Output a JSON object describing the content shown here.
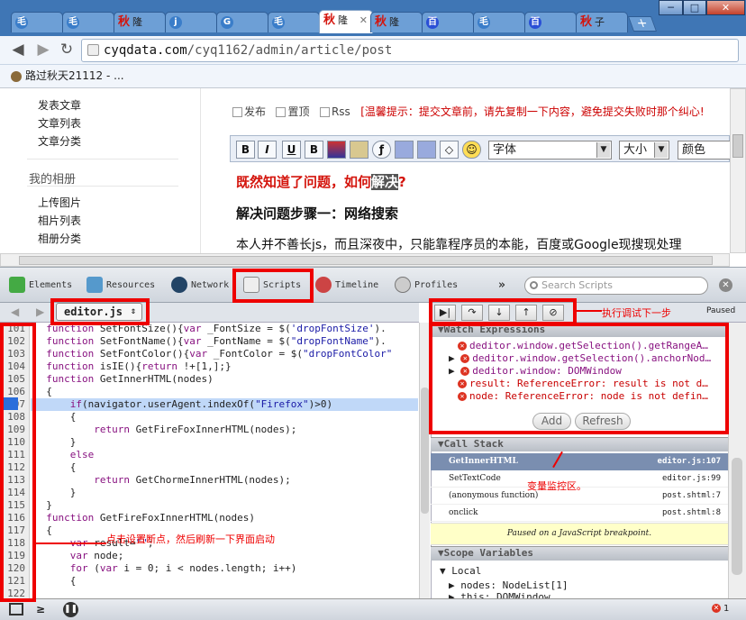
{
  "browser": {
    "tabs": [
      {
        "icon": "generic-favicon",
        "label": "毛",
        "active": false
      },
      {
        "icon": "generic-favicon",
        "label": "毛",
        "active": false
      },
      {
        "icon": "qiu-favicon",
        "label": "秋",
        "sub": "隆",
        "active": false
      },
      {
        "icon": "generic-favicon",
        "label": "j",
        "active": false
      },
      {
        "icon": "generic-favicon",
        "label": "G",
        "active": false
      },
      {
        "icon": "generic-favicon",
        "label": "毛",
        "active": false
      },
      {
        "icon": "qiu-favicon",
        "label": "秋",
        "sub": "隆",
        "active": true
      },
      {
        "icon": "qiu-favicon",
        "label": "秋",
        "sub": "隆",
        "active": false
      },
      {
        "icon": "baidu-favicon",
        "label": "百",
        "active": false
      },
      {
        "icon": "generic-favicon",
        "label": "毛",
        "active": false
      },
      {
        "icon": "baidu-favicon",
        "label": "百",
        "active": false
      },
      {
        "icon": "qiu-favicon",
        "label": "秋",
        "sub": "子",
        "active": false
      }
    ],
    "url_host": "cyqdata.com",
    "url_path": "/cyq1162/admin/article/post",
    "bookmark": "路过秋天21112 - ..."
  },
  "page": {
    "sidebar_group1": [
      "发表文章",
      "文章列表",
      "文章分类"
    ],
    "sidebar_head2": "我的相册",
    "sidebar_group2": [
      "上传图片",
      "相片列表",
      "相册分类"
    ],
    "options": [
      "发布",
      "置顶",
      "Rss"
    ],
    "tip": "[温馨提示：提交文章前，请先复制一下内容，避免提交失败时那个纠心!",
    "editor_buttons": [
      "B",
      "I",
      "U",
      "B"
    ],
    "font_select": "字体",
    "size_select": "大小",
    "color_select": "颜色",
    "heading_red": "既然知道了问题，如何",
    "heading_red_sel": "解决",
    "heading_red_end": "?",
    "heading2": "解决问题步骤一：网络搜索",
    "body_text": "本人并不善长js，而且深夜中，只能靠程序员的本能，百度或Google现搜现处理"
  },
  "devtools": {
    "tabs": [
      "Elements",
      "Resources",
      "Network",
      "Scripts",
      "Timeline",
      "Profiles"
    ],
    "more": "»",
    "search_placeholder": "Search Scripts",
    "file": "editor.js",
    "paused_label": "Paused",
    "line_numbers": [
      "101",
      "102",
      "103",
      "104",
      "105",
      "106",
      "107",
      "108",
      "109",
      "110",
      "111",
      "112",
      "113",
      "114",
      "115",
      "116",
      "117",
      "118",
      "119",
      "120",
      "121",
      "122"
    ],
    "watch_title": "Watch Expressions",
    "watch": [
      "deditor.window.getSelection().getRangeA…",
      "deditor.window.getSelection().anchorNod…",
      "deditor.window: DOMWindow",
      "result: ReferenceError: result is not d…",
      "node: ReferenceError: node is not defin…"
    ],
    "add_label": "Add",
    "refresh_label": "Refresh",
    "callstack_title": "Call Stack",
    "callstack": [
      {
        "fn": "GetInnerHTML",
        "loc": "editor.js:107"
      },
      {
        "fn": "SetTextCode",
        "loc": "editor.js:99"
      },
      {
        "fn": "(anonymous function)",
        "loc": "post.shtml:7"
      },
      {
        "fn": "onclick",
        "loc": "post.shtml:8"
      }
    ],
    "paused_msg": "Paused on a JavaScript breakpoint.",
    "scope_title": "Scope Variables",
    "scope_local": "Local",
    "scope_vars": [
      "nodes: NodeList[1]",
      "this: DOMWindow"
    ],
    "error_count": "1"
  },
  "annotations": {
    "step": "执行调试下一步",
    "watch": "变量监控区。",
    "breakpoint": "点击设置断点，然后刷新一下界面启动"
  }
}
